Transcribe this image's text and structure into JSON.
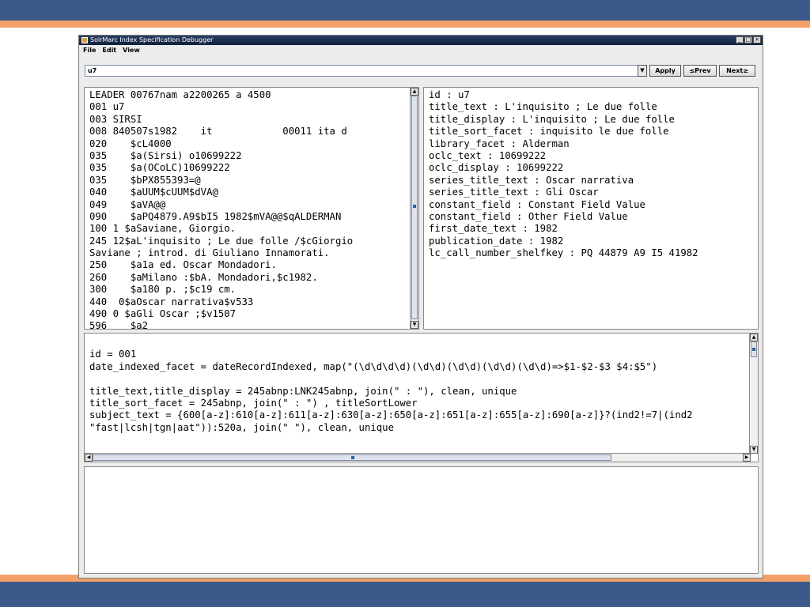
{
  "window": {
    "title": "SolrMarc Index Specification Debugger"
  },
  "menu": [
    "File",
    "Edit",
    "View"
  ],
  "toolbar": {
    "record_id_value": "u7",
    "dropdown_icon": "chevron-down-icon",
    "apply_label": "Apply",
    "prev_label": "≤Prev",
    "next_label": "Next≥"
  },
  "marc_record": [
    "LEADER 00767nam a2200265 a 4500",
    "001 u7",
    "003 SIRSI",
    "008 840507s1982    it            00011 ita d",
    "020    $cL4000",
    "035    $a(Sirsi) o10699222",
    "035    $a(OCoLC)10699222",
    "035    $bPX855393=@",
    "040    $aUUM$cUUM$dVA@",
    "049    $aVA@@",
    "090    $aPQ4879.A9$bI5 1982$mVA@@$qALDERMAN",
    "100 1 $aSaviane, Giorgio.",
    "245 12$aL'inquisito ; Le due folle /$cGiorgio",
    "Saviane ; introd. di Giuliano Innamorati.",
    "250    $a1a ed. Oscar Mondadori.",
    "260    $aMilano :$bA. Mondadori,$c1982.",
    "300    $a180 p. ;$c19 cm.",
    "440  0$aOscar narrativa$v533",
    "490 0 $aGli Oscar ;$v1507",
    "596    $a2"
  ],
  "index_output": [
    "id : u7",
    "title_text : L'inquisito ; Le due folle",
    "title_display : L'inquisito ; Le due folle",
    "title_sort_facet : inquisito le due folle",
    "library_facet : Alderman",
    "oclc_text : 10699222",
    "oclc_display : 10699222",
    "series_title_text : Oscar narrativa",
    "series_title_text : Gli Oscar",
    "constant_field : Constant Field Value",
    "constant_field : Other Field Value",
    "first_date_text : 1982",
    "publication_date : 1982",
    "lc_call_number_shelfkey : PQ 44879 A9 I5 41982"
  ],
  "spec_lines": [
    "",
    "id = 001",
    "date_indexed_facet = dateRecordIndexed, map(\"(\\d\\d\\d\\d)(\\d\\d)(\\d\\d)(\\d\\d)(\\d\\d)=>$1-$2-$3 $4:$5\")",
    "",
    "title_text,title_display = 245abnp:LNK245abnp, join(\" : \"), clean, unique",
    "title_sort_facet = 245abnp, join(\" : \") , titleSortLower",
    "subject_text = {600[a-z]:610[a-z]:611[a-z]:630[a-z]:650[a-z]:651[a-z]:655[a-z]:690[a-z]}?(ind2!=7|(ind2",
    "\"fast|lcsh|tgn|aat\")):520a, join(\" \"), clean, unique"
  ],
  "messages": []
}
